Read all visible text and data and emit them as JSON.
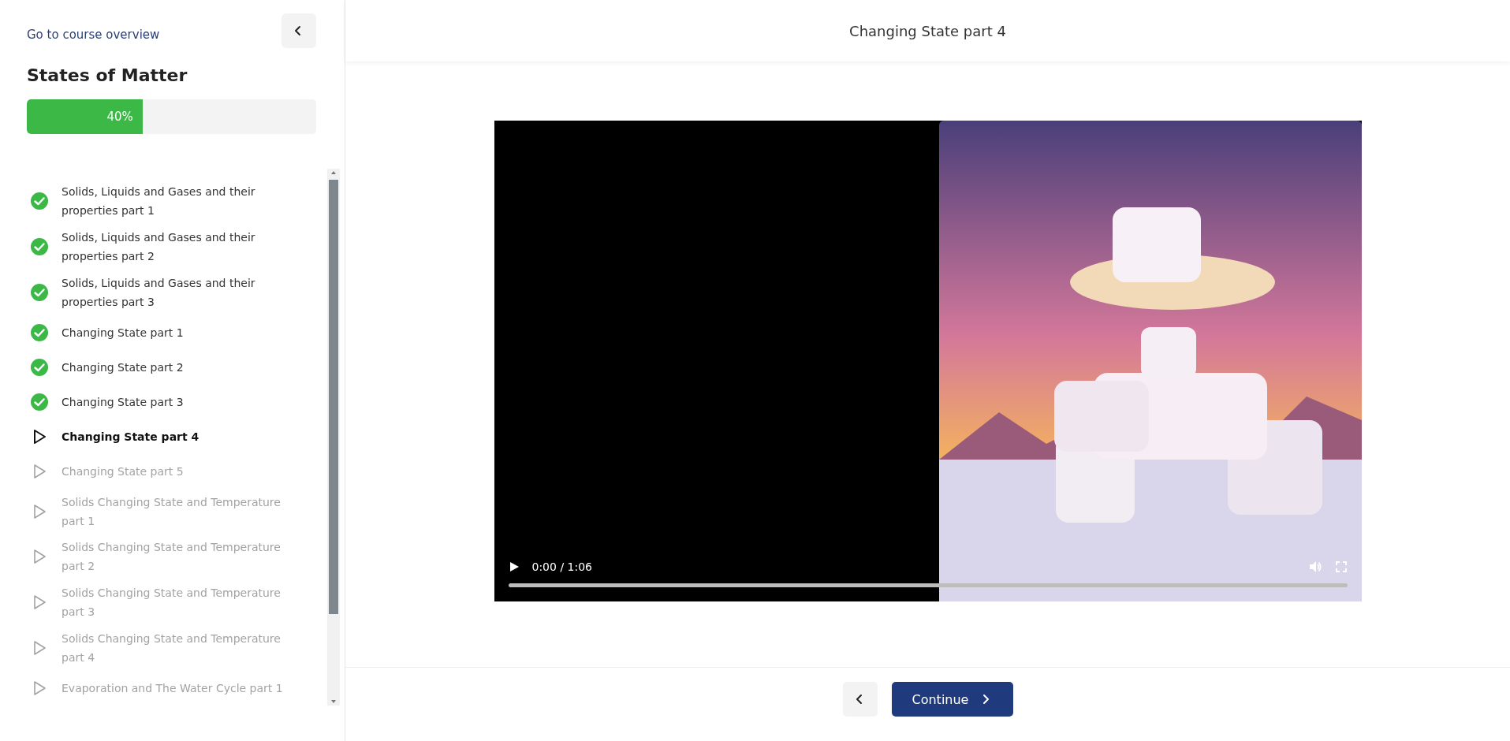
{
  "sidebar": {
    "overview_link": "Go to course overview",
    "course_title": "States of Matter",
    "progress": {
      "level": 0.4,
      "label": "40%"
    },
    "lessons": [
      {
        "title": "Solids, Liquids and Gases and their properties part 1",
        "kind": "completed"
      },
      {
        "title": "Solids, Liquids and Gases and their properties part 2",
        "kind": "completed"
      },
      {
        "title": "Solids, Liquids and Gases and their properties part 3",
        "kind": "completed"
      },
      {
        "title": "Changing State part 1",
        "kind": "completed"
      },
      {
        "title": "Changing State part 2",
        "kind": "completed"
      },
      {
        "title": "Changing State part 3",
        "kind": "completed"
      },
      {
        "title": "Changing State part 4",
        "kind": "current"
      },
      {
        "title": "Changing State part 5",
        "kind": "upcoming"
      },
      {
        "title": "Solids Changing State and Temperature part 1",
        "kind": "upcoming"
      },
      {
        "title": "Solids Changing State and Temperature part 2",
        "kind": "upcoming"
      },
      {
        "title": "Solids Changing State and Temperature part 3",
        "kind": "upcoming"
      },
      {
        "title": "Solids Changing State and Temperature part 4",
        "kind": "upcoming"
      },
      {
        "title": "Evaporation and The Water Cycle part 1",
        "kind": "upcoming"
      }
    ]
  },
  "header": {
    "title": "Changing State part 4"
  },
  "video": {
    "kind": "picture",
    "time": "0:00 / 1:06",
    "playback": {
      "level": 0
    }
  },
  "footer": {
    "continue_button": "Continue"
  }
}
